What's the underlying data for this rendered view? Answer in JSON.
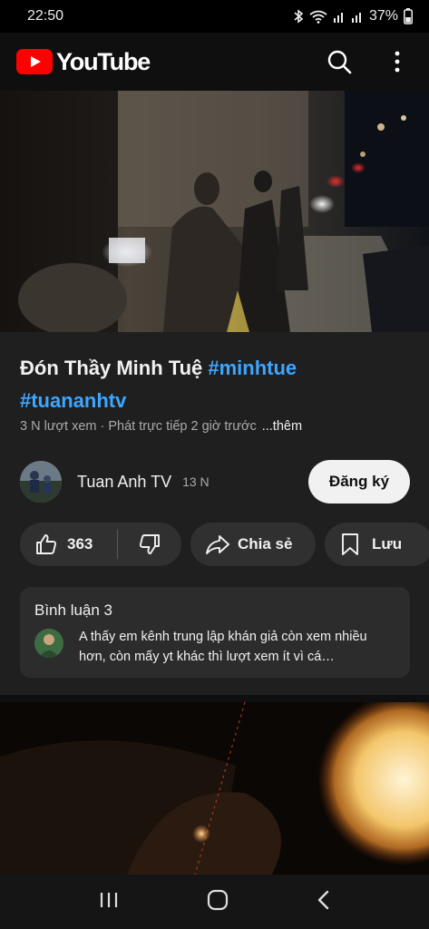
{
  "status_bar": {
    "time": "22:50",
    "battery": "37%"
  },
  "app_bar": {
    "logo_text": "YouTube",
    "brand_color": "#ff0000"
  },
  "video": {
    "title_main": "Đón Thầy Minh Tuệ ",
    "hashtag_1": "#minhtue",
    "hashtag_2": "#tuananhtv",
    "meta": "3 N lượt xem · Phát trực tiếp 2 giờ trước",
    "more_label": "...thêm"
  },
  "channel": {
    "name": "Tuan Anh TV",
    "subscribers": "13 N",
    "subscribe_label": "Đăng ký"
  },
  "actions": {
    "like_count": "363",
    "share_label": "Chia sẻ",
    "save_label": "Lưu"
  },
  "comments": {
    "title": "Bình luận 3",
    "preview": "A thấy em kênh trung lập khán giả còn xem nhiều hơn, còn mấy yt khác thì lượt xem ít vì cá…"
  },
  "icons": {
    "logo": "youtube-play-icon",
    "search": "search-icon",
    "menu": "more-vert-icon",
    "like": "thumbs-up-icon",
    "dislike": "thumbs-down-icon",
    "share": "share-arrow-icon",
    "save": "bookmark-icon",
    "nav_recents": "recents-icon",
    "nav_home": "home-icon",
    "nav_back": "back-icon"
  }
}
